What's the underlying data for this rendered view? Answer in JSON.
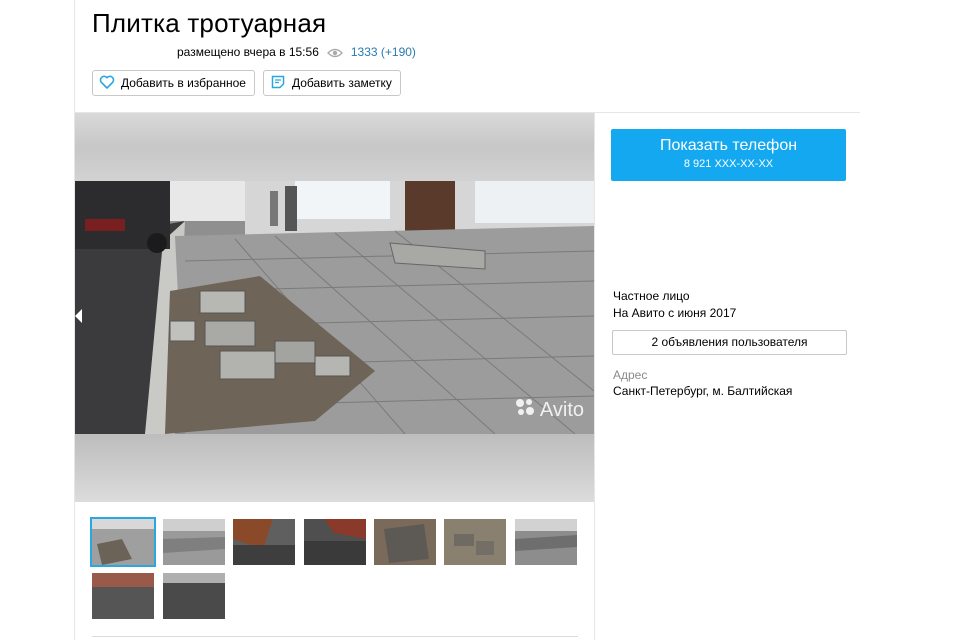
{
  "listing": {
    "title": "Плитка тротуарная",
    "posted": "размещено вчера в 15:56",
    "views": "1333 (+190)"
  },
  "actions": {
    "favorite_label": "Добавить в избранное",
    "note_label": "Добавить заметку"
  },
  "gallery": {
    "watermark": "Avito",
    "thumbnail_count": 9,
    "active_index": 0
  },
  "contact": {
    "show_phone_label": "Показать телефон",
    "phone_masked": "8 921 XXX-XX-XX"
  },
  "seller": {
    "type": "Частное лицо",
    "since": "На Авито с июня 2017",
    "ads_link": "2 объявления пользователя"
  },
  "address": {
    "label": "Адрес",
    "value": "Санкт-Петербург, м. Балтийская"
  },
  "colors": {
    "accent": "#14a8f0",
    "link": "#2a7ab0"
  },
  "icons": [
    "eye-icon",
    "heart-icon",
    "note-icon",
    "avito-logo-icon",
    "chevron-left-icon"
  ]
}
